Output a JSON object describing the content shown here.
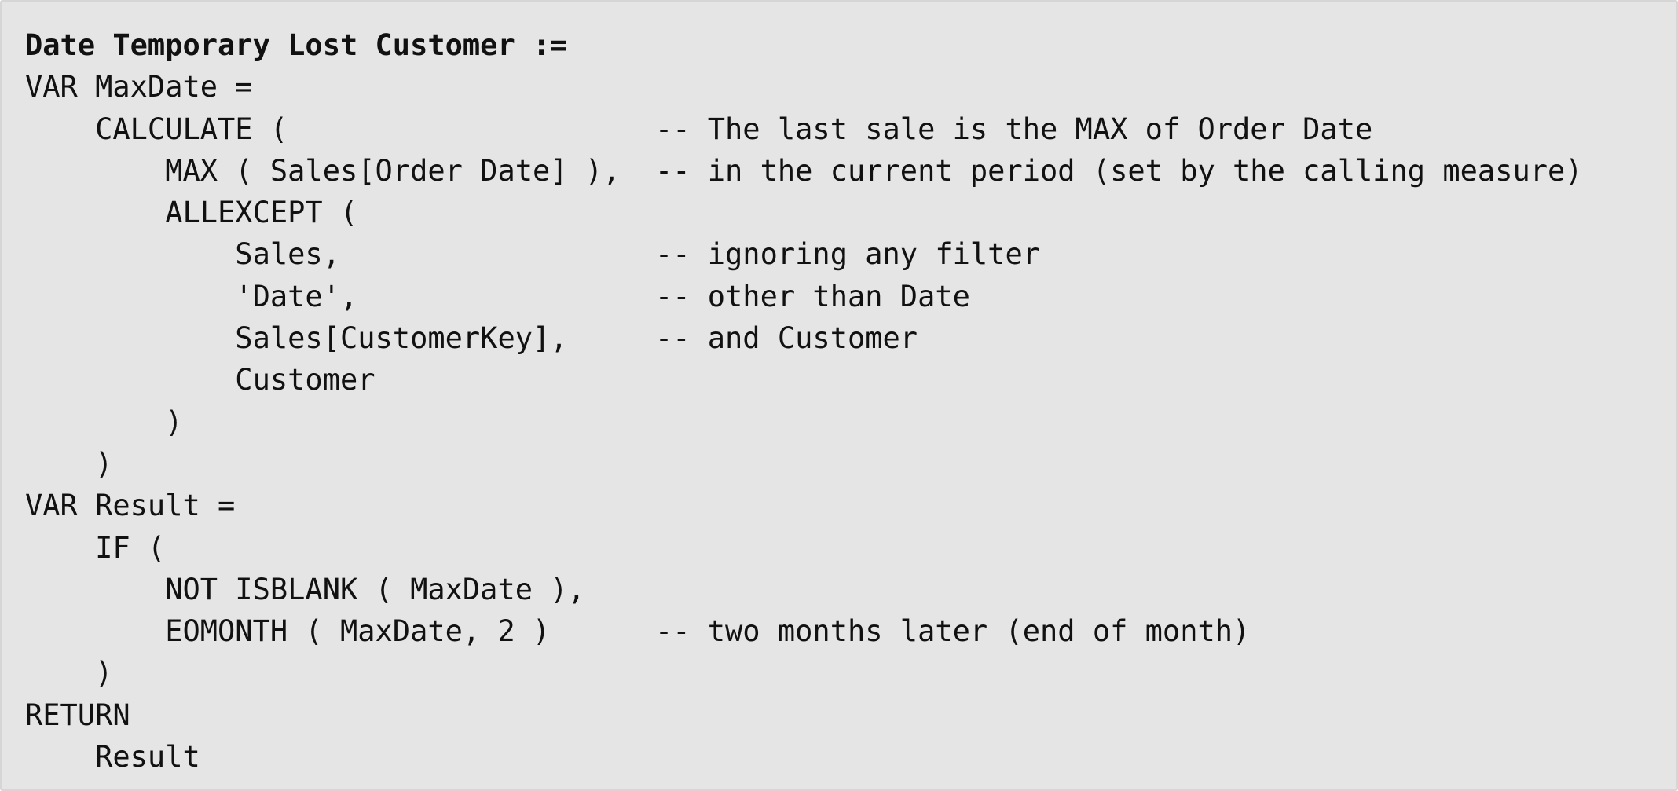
{
  "code": {
    "lines": [
      "Date Temporary Lost Customer :=",
      "VAR MaxDate =",
      "    CALCULATE (                     -- The last sale is the MAX of Order Date",
      "        MAX ( Sales[Order Date] ),  -- in the current period (set by the calling measure)",
      "        ALLEXCEPT (",
      "            Sales,                  -- ignoring any filter",
      "            'Date',                 -- other than Date",
      "            Sales[CustomerKey],     -- and Customer",
      "            Customer",
      "        )",
      "    )",
      "VAR Result =",
      "    IF (",
      "        NOT ISBLANK ( MaxDate ),",
      "        EOMONTH ( MaxDate, 2 )      -- two months later (end of month)",
      "    )",
      "RETURN",
      "    Result"
    ]
  }
}
